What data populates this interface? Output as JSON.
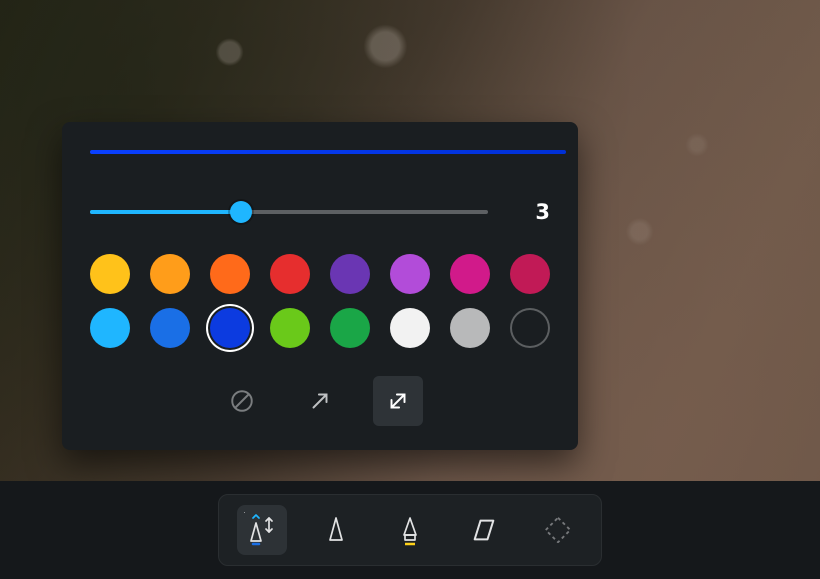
{
  "panel": {
    "preview_color": "#0a40ff",
    "slider": {
      "value_label": "3",
      "fill_percent": 38
    },
    "colors": {
      "row1": [
        {
          "name": "yellow",
          "hex": "#ffc21a"
        },
        {
          "name": "amber",
          "hex": "#ff9d1a"
        },
        {
          "name": "orange",
          "hex": "#ff6a1a"
        },
        {
          "name": "red",
          "hex": "#e62e2e"
        },
        {
          "name": "purple",
          "hex": "#6a36b3"
        },
        {
          "name": "violet",
          "hex": "#b24cd9"
        },
        {
          "name": "magenta",
          "hex": "#d11a8a"
        },
        {
          "name": "crimson",
          "hex": "#c11a56"
        }
      ],
      "row2": [
        {
          "name": "sky",
          "hex": "#1fb6ff"
        },
        {
          "name": "blue",
          "hex": "#1a6fe6"
        },
        {
          "name": "royal-blue",
          "hex": "#0c3be0",
          "selected": true
        },
        {
          "name": "lime",
          "hex": "#6ac91a"
        },
        {
          "name": "green",
          "hex": "#1aa647"
        },
        {
          "name": "white",
          "hex": "#f2f2f2"
        },
        {
          "name": "gray",
          "hex": "#b8b9ba"
        },
        {
          "name": "none",
          "hex": "",
          "hollow": true
        }
      ]
    },
    "arrow_styles": [
      {
        "name": "none",
        "selected": false,
        "disabled": true
      },
      {
        "name": "single",
        "selected": false
      },
      {
        "name": "double",
        "selected": true
      }
    ]
  },
  "toolbar": {
    "tools": [
      {
        "name": "pen-arrow",
        "active": true,
        "underline": "#1a6fe6"
      },
      {
        "name": "pen",
        "active": false
      },
      {
        "name": "highlighter",
        "active": false,
        "underline": "#ffd21a"
      },
      {
        "name": "eraser",
        "active": false
      },
      {
        "name": "shape",
        "active": false,
        "dim": true
      }
    ]
  }
}
